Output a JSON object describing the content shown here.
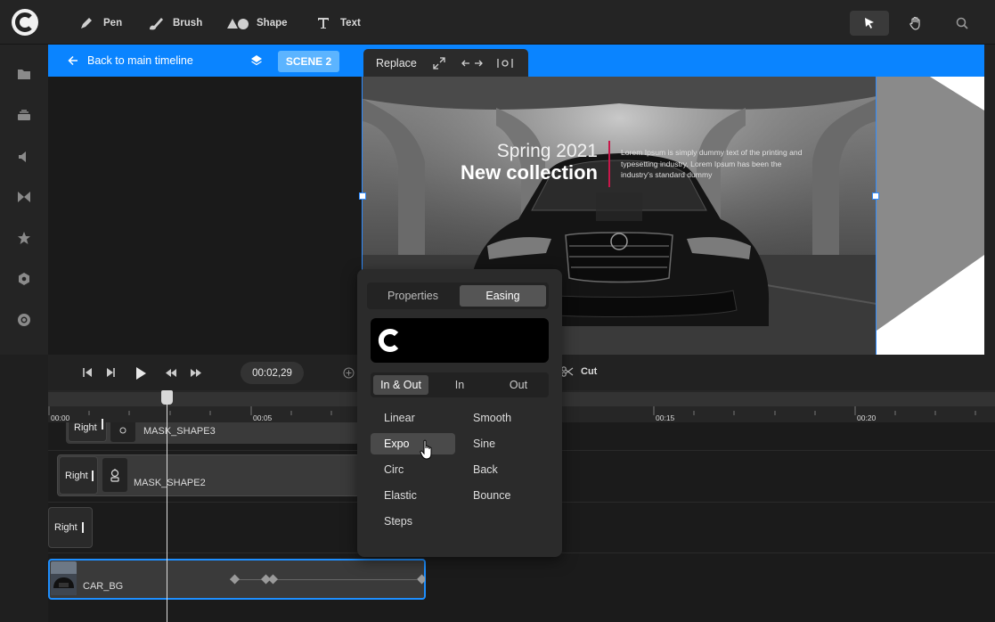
{
  "toolbar": {
    "tools": [
      {
        "label": "Pen",
        "icon": "pen-icon"
      },
      {
        "label": "Brush",
        "icon": "brush-icon"
      },
      {
        "label": "Shape",
        "icon": "shape-icon"
      },
      {
        "label": "Text",
        "icon": "text-icon"
      }
    ],
    "right": [
      "cursor-icon",
      "hand-icon",
      "search-icon"
    ]
  },
  "sidebar": {
    "icons": [
      "folder-icon",
      "layers-icon",
      "audio-icon",
      "transition-icon",
      "star-icon",
      "settings-icon",
      "record-icon"
    ]
  },
  "scenebar": {
    "back_label": "Back to main timeline",
    "scene_label": "SCENE 2",
    "replace_label": "Replace"
  },
  "canvas": {
    "title_line1": "Spring 2021",
    "title_line2": "New collection",
    "body_text": "Lorem Ipsum is simply dummy text of the printing and typesetting industry. Lorem Ipsum has been the industry's standard dummy"
  },
  "timeline": {
    "timecode": "00:02,29",
    "cut_label": "Cut",
    "ruler_labels": [
      "00:00",
      "00:05",
      "00:15",
      "00:20"
    ],
    "tracks": [
      {
        "chip": "Right",
        "name": "MASK_SHAPE3"
      },
      {
        "chip": "Right",
        "name": "MASK_SHAPE2"
      },
      {
        "chip": "Right",
        "name": ""
      },
      {
        "chip": "",
        "name": "CAR_BG"
      }
    ]
  },
  "easing_popup": {
    "tabs": [
      "Properties",
      "Easing"
    ],
    "active_tab": "Easing",
    "modes": [
      "In & Out",
      "In",
      "Out"
    ],
    "active_mode": "In & Out",
    "options_left": [
      "Linear",
      "Expo",
      "Circ",
      "Elastic",
      "Steps"
    ],
    "options_right": [
      "Smooth",
      "Sine",
      "Back",
      "Bounce"
    ],
    "selected": "Expo"
  },
  "colors": {
    "accent": "#0a84ff",
    "scene_chip": "#5cb4ff",
    "title_rule": "#c8174a"
  }
}
